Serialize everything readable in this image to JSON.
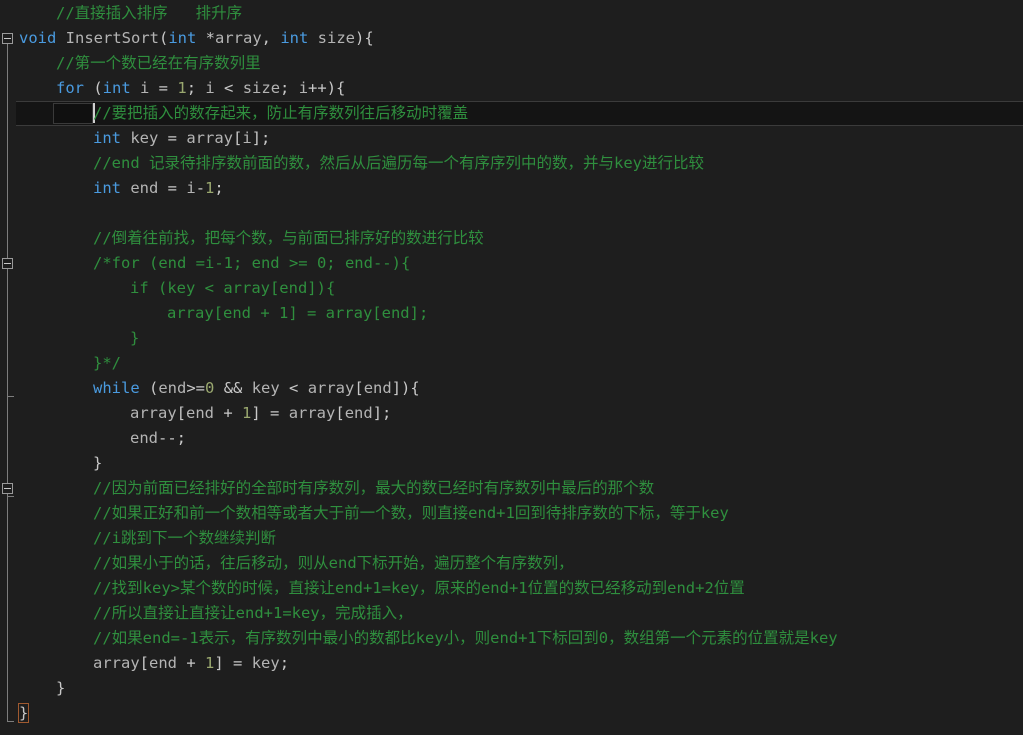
{
  "editor": {
    "name": "code-editor",
    "language": "C/C++",
    "theme": "dark",
    "colors": {
      "background": "#1e1e1e",
      "comment": "#2f8f3e",
      "keyword": "#4a9be0",
      "identifier": "#b4b4b4",
      "number": "#9aa86f",
      "punctuation": "#c8c8c8",
      "active_line_background": "#141414",
      "selection_background": "#101010",
      "caret": "#d0d0d0",
      "fold_marker_border": "#9a9a9a",
      "fold_guide_line": "#7d7d7d",
      "brace_match_outline": "#a05a30"
    },
    "active_line_index": 4,
    "caret_line_index": 4
  },
  "fold_markers": [
    {
      "name": "fold-marker-function",
      "line": 1,
      "state": "expanded",
      "guide_to_line": 28
    },
    {
      "name": "fold-marker-block-comment",
      "line": 10,
      "state": "expanded",
      "guide_to_line": 15
    },
    {
      "name": "fold-marker-while-block",
      "line": 19,
      "state": "expanded",
      "guide_to_line": 19
    }
  ],
  "code": {
    "lines": [
      {
        "indent": 1,
        "tokens": [
          {
            "t": "cmt",
            "v": "//直接插入排序   排升序"
          }
        ]
      },
      {
        "indent": 0,
        "tokens": [
          {
            "t": "kw",
            "v": "void"
          },
          {
            "t": "id",
            "v": " InsertSort"
          },
          {
            "t": "pun",
            "v": "("
          },
          {
            "t": "kw",
            "v": "int"
          },
          {
            "t": "pun",
            "v": " *"
          },
          {
            "t": "id",
            "v": "array"
          },
          {
            "t": "pun",
            "v": ", "
          },
          {
            "t": "kw",
            "v": "int"
          },
          {
            "t": "id",
            "v": " size"
          },
          {
            "t": "pun",
            "v": "){"
          }
        ]
      },
      {
        "indent": 1,
        "tokens": [
          {
            "t": "cmt",
            "v": "//第一个数已经在有序数列里"
          }
        ]
      },
      {
        "indent": 1,
        "tokens": [
          {
            "t": "kw",
            "v": "for"
          },
          {
            "t": "pun",
            "v": " ("
          },
          {
            "t": "kw",
            "v": "int"
          },
          {
            "t": "id",
            "v": " i "
          },
          {
            "t": "pun",
            "v": "= "
          },
          {
            "t": "num",
            "v": "1"
          },
          {
            "t": "pun",
            "v": "; "
          },
          {
            "t": "id",
            "v": "i "
          },
          {
            "t": "pun",
            "v": "< "
          },
          {
            "t": "id",
            "v": "size"
          },
          {
            "t": "pun",
            "v": "; "
          },
          {
            "t": "id",
            "v": "i"
          },
          {
            "t": "pun",
            "v": "++){"
          }
        ]
      },
      {
        "indent": 2,
        "tokens": [
          {
            "t": "cmt",
            "v": "//要把插入的数存起来，防止有序数列往后移动时覆盖"
          }
        ]
      },
      {
        "indent": 2,
        "tokens": [
          {
            "t": "kw",
            "v": "int"
          },
          {
            "t": "id",
            "v": " key "
          },
          {
            "t": "pun",
            "v": "= "
          },
          {
            "t": "id",
            "v": "array"
          },
          {
            "t": "pun",
            "v": "["
          },
          {
            "t": "id",
            "v": "i"
          },
          {
            "t": "pun",
            "v": "];"
          }
        ]
      },
      {
        "indent": 2,
        "tokens": [
          {
            "t": "cmt",
            "v": "//end 记录待排序数前面的数，然后从后遍历每一个有序序列中的数，并与key进行比较"
          }
        ]
      },
      {
        "indent": 2,
        "tokens": [
          {
            "t": "kw",
            "v": "int"
          },
          {
            "t": "id",
            "v": " end "
          },
          {
            "t": "pun",
            "v": "= "
          },
          {
            "t": "id",
            "v": "i"
          },
          {
            "t": "pun",
            "v": "-"
          },
          {
            "t": "num",
            "v": "1"
          },
          {
            "t": "pun",
            "v": ";"
          }
        ]
      },
      {
        "indent": 0,
        "tokens": []
      },
      {
        "indent": 2,
        "tokens": [
          {
            "t": "cmt",
            "v": "//倒着往前找，把每个数，与前面已排序好的数进行比较"
          }
        ]
      },
      {
        "indent": 2,
        "tokens": [
          {
            "t": "cmt",
            "v": "/*for (end =i-1; end >= 0; end--){"
          }
        ]
      },
      {
        "indent": 3,
        "tokens": [
          {
            "t": "cmt",
            "v": "if (key < array[end]){"
          }
        ]
      },
      {
        "indent": 4,
        "tokens": [
          {
            "t": "cmt",
            "v": "array[end + 1] = array[end];"
          }
        ]
      },
      {
        "indent": 3,
        "tokens": [
          {
            "t": "cmt",
            "v": "}"
          }
        ]
      },
      {
        "indent": 2,
        "tokens": [
          {
            "t": "cmt",
            "v": "}*/"
          }
        ]
      },
      {
        "indent": 2,
        "tokens": [
          {
            "t": "kw",
            "v": "while"
          },
          {
            "t": "pun",
            "v": " ("
          },
          {
            "t": "id",
            "v": "end"
          },
          {
            "t": "pun",
            "v": ">="
          },
          {
            "t": "num",
            "v": "0"
          },
          {
            "t": "pun",
            "v": " && "
          },
          {
            "t": "id",
            "v": "key "
          },
          {
            "t": "pun",
            "v": "< "
          },
          {
            "t": "id",
            "v": "array"
          },
          {
            "t": "pun",
            "v": "["
          },
          {
            "t": "id",
            "v": "end"
          },
          {
            "t": "pun",
            "v": "]){"
          }
        ]
      },
      {
        "indent": 3,
        "tokens": [
          {
            "t": "id",
            "v": "array"
          },
          {
            "t": "pun",
            "v": "["
          },
          {
            "t": "id",
            "v": "end "
          },
          {
            "t": "pun",
            "v": "+ "
          },
          {
            "t": "num",
            "v": "1"
          },
          {
            "t": "pun",
            "v": "] = "
          },
          {
            "t": "id",
            "v": "array"
          },
          {
            "t": "pun",
            "v": "["
          },
          {
            "t": "id",
            "v": "end"
          },
          {
            "t": "pun",
            "v": "];"
          }
        ]
      },
      {
        "indent": 3,
        "tokens": [
          {
            "t": "id",
            "v": "end"
          },
          {
            "t": "pun",
            "v": "--;"
          }
        ]
      },
      {
        "indent": 2,
        "tokens": [
          {
            "t": "pun",
            "v": "}"
          }
        ]
      },
      {
        "indent": 2,
        "tokens": [
          {
            "t": "cmt",
            "v": "//因为前面已经排好的全部时有序数列，最大的数已经时有序数列中最后的那个数"
          }
        ]
      },
      {
        "indent": 2,
        "tokens": [
          {
            "t": "cmt",
            "v": "//如果正好和前一个数相等或者大于前一个数，则直接end+1回到待排序数的下标，等于key"
          }
        ]
      },
      {
        "indent": 2,
        "tokens": [
          {
            "t": "cmt",
            "v": "//i跳到下一个数继续判断"
          }
        ]
      },
      {
        "indent": 2,
        "tokens": [
          {
            "t": "cmt",
            "v": "//如果小于的话，往后移动，则从end下标开始，遍历整个有序数列，"
          }
        ]
      },
      {
        "indent": 2,
        "tokens": [
          {
            "t": "cmt",
            "v": "//找到key>某个数的时候，直接让end+1=key，原来的end+1位置的数已经移动到end+2位置"
          }
        ]
      },
      {
        "indent": 2,
        "tokens": [
          {
            "t": "cmt",
            "v": "//所以直接让直接让end+1=key，完成插入，"
          }
        ]
      },
      {
        "indent": 2,
        "tokens": [
          {
            "t": "cmt",
            "v": "//如果end=-1表示，有序数列中最小的数都比key小，则end+1下标回到0，数组第一个元素的位置就是key"
          }
        ]
      },
      {
        "indent": 2,
        "tokens": [
          {
            "t": "id",
            "v": "array"
          },
          {
            "t": "pun",
            "v": "["
          },
          {
            "t": "id",
            "v": "end "
          },
          {
            "t": "pun",
            "v": "+ "
          },
          {
            "t": "num",
            "v": "1"
          },
          {
            "t": "pun",
            "v": "] = "
          },
          {
            "t": "id",
            "v": "key"
          },
          {
            "t": "pun",
            "v": ";"
          }
        ]
      },
      {
        "indent": 1,
        "tokens": [
          {
            "t": "pun",
            "v": "}"
          }
        ]
      },
      {
        "indent": 0,
        "tokens": [
          {
            "t": "brace-hl",
            "v": "}"
          }
        ]
      }
    ]
  }
}
